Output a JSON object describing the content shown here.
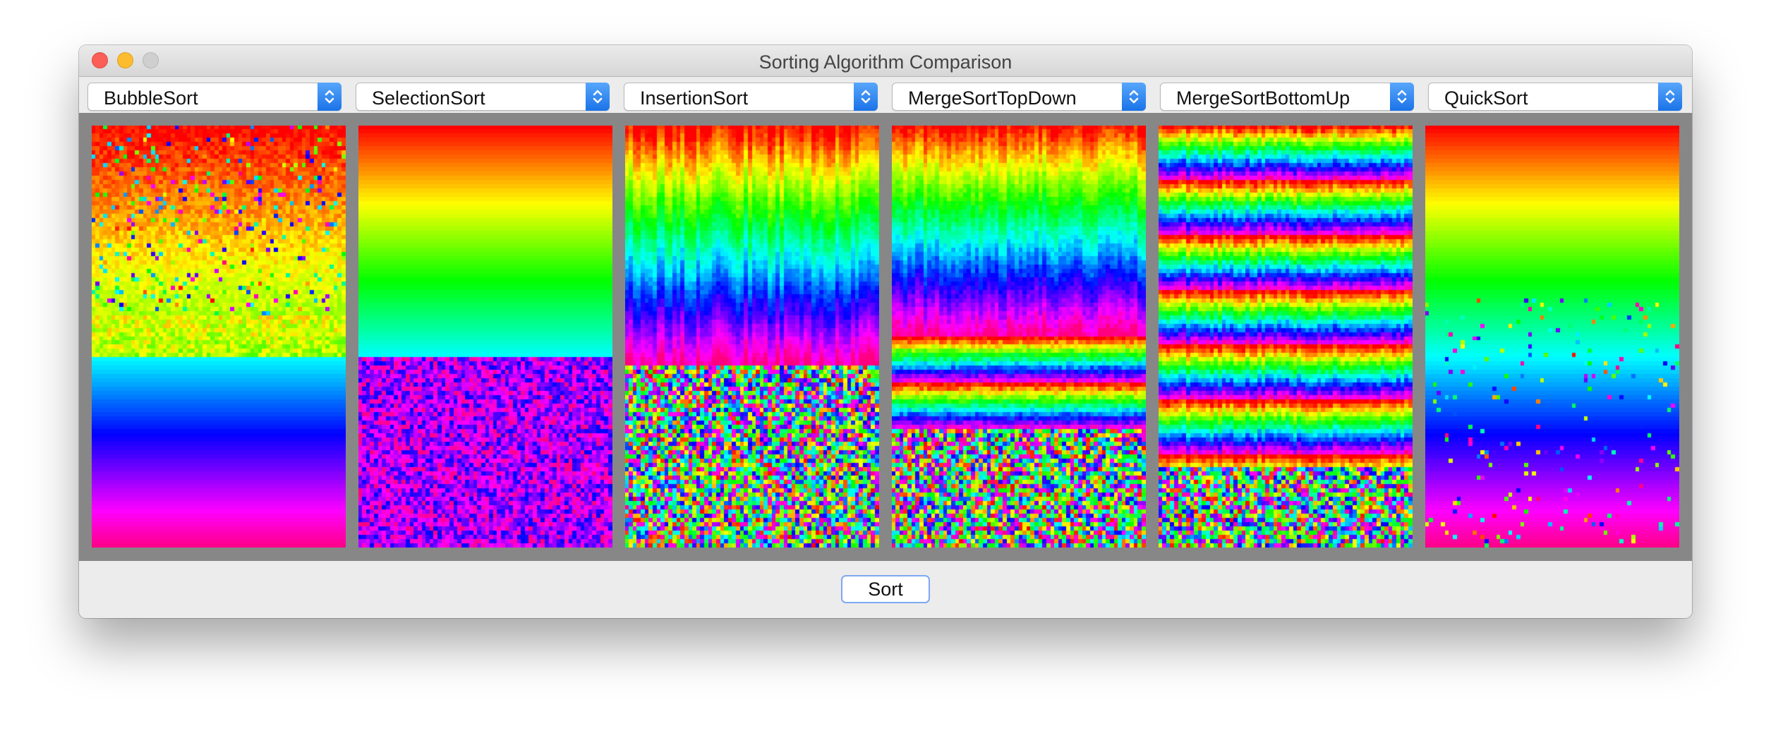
{
  "window": {
    "title": "Sorting Algorithm Comparison"
  },
  "algorithms": [
    {
      "label": "BubbleSort",
      "progress": 0.55,
      "pattern": "bubble"
    },
    {
      "label": "SelectionSort",
      "progress": 0.55,
      "pattern": "selection"
    },
    {
      "label": "InsertionSort",
      "progress": 0.57,
      "pattern": "insertion"
    },
    {
      "label": "MergeSortTopDown",
      "progress": 0.5,
      "pattern": "merge-topdown"
    },
    {
      "label": "MergeSortBottomUp",
      "progress": 0.8,
      "pattern": "merge-bottomup"
    },
    {
      "label": "QuickSort",
      "progress": 0.75,
      "pattern": "quick"
    }
  ],
  "sort_button": {
    "label": "Sort"
  },
  "icons": {
    "dropdown": "up-down-chevron-icon"
  },
  "colors": {
    "canvas_background": "#878787",
    "stepper_accent": "#1a73e8",
    "close": "#fc5f57",
    "minimize": "#fdbc2e",
    "zoom_disabled": "#cfcfcf"
  }
}
